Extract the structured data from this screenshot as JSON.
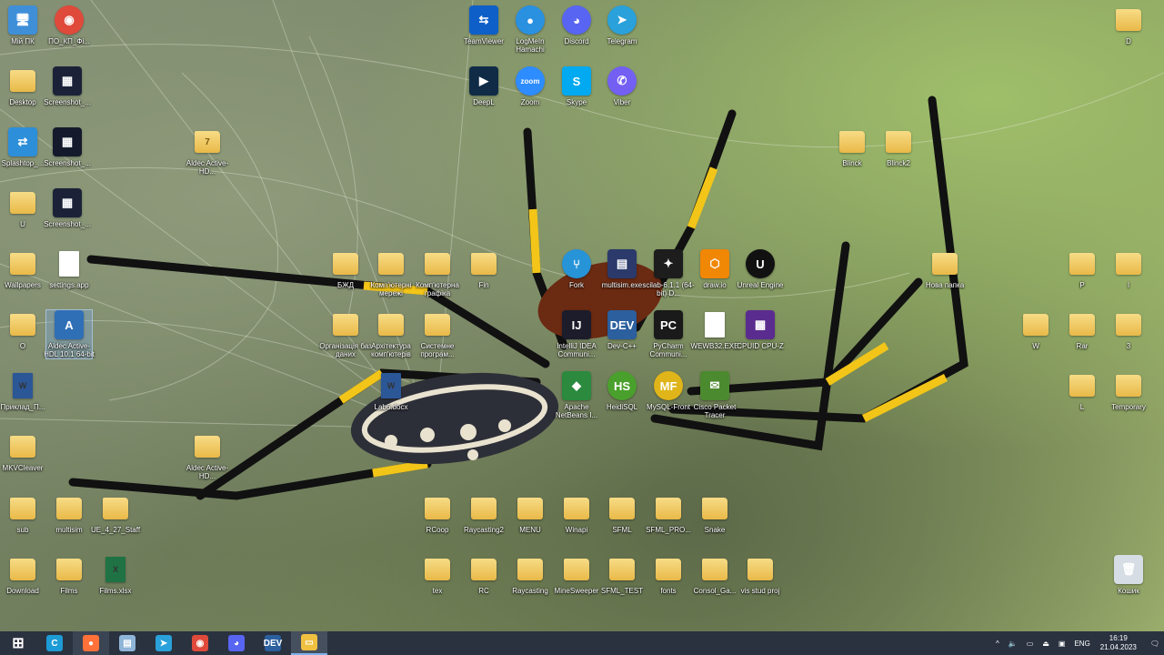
{
  "desktop": {
    "icons": [
      {
        "id": "my-pc",
        "label": "Мій ПК",
        "glyph": "🖥",
        "color": "#3f8fd8",
        "kind": "app"
      },
      {
        "id": "chrome-desktop",
        "label": "ПО_КП_Фі...",
        "glyph": "◉",
        "color": "#e04a3b",
        "kind": "round"
      },
      {
        "id": "desktop-folder",
        "label": "Desktop",
        "glyph": "",
        "kind": "folder"
      },
      {
        "id": "screenshot-1",
        "label": "Screenshot_...",
        "glyph": "▦",
        "color": "#1b2238",
        "kind": "app"
      },
      {
        "id": "splashtop",
        "label": "Splashtop_...",
        "glyph": "⇄",
        "color": "#2d8fd9",
        "kind": "app"
      },
      {
        "id": "screenshot-2",
        "label": "Screenshot_...",
        "glyph": "▦",
        "color": "#141a2c",
        "kind": "app"
      },
      {
        "id": "u-folder",
        "label": "U",
        "glyph": "",
        "kind": "folder"
      },
      {
        "id": "screenshot-3",
        "label": "Screenshot_...",
        "glyph": "▦",
        "color": "#1b2238",
        "kind": "app"
      },
      {
        "id": "wallpapers-folder",
        "label": "Wallpapers",
        "glyph": "",
        "kind": "folder"
      },
      {
        "id": "settings-app",
        "label": "settings.app",
        "glyph": "",
        "kind": "file"
      },
      {
        "id": "o-folder",
        "label": "O",
        "glyph": "",
        "kind": "folder"
      },
      {
        "id": "aldec-selected",
        "label": "Aldec Active-HDL 10.1 64-bit",
        "glyph": "A",
        "color": "#2f6fb6",
        "kind": "app"
      },
      {
        "id": "prykład",
        "label": "Приклад_П...",
        "glyph": "W",
        "color": "#2b5797",
        "kind": "file"
      },
      {
        "id": "mkvcleaver",
        "label": "MKVCleaver",
        "glyph": "",
        "kind": "folder"
      },
      {
        "id": "sub-folder",
        "label": "sub",
        "glyph": "",
        "kind": "folder"
      },
      {
        "id": "multisim-folder",
        "label": "multisim",
        "glyph": "",
        "kind": "folder"
      },
      {
        "id": "ue-staff",
        "label": "UE_4_27_Staff",
        "glyph": "",
        "kind": "folder"
      },
      {
        "id": "download-folder",
        "label": "Download",
        "glyph": "",
        "kind": "folder"
      },
      {
        "id": "films-folder",
        "label": "Films",
        "glyph": "",
        "kind": "folder"
      },
      {
        "id": "films-xlsx",
        "label": "Films.xlsx",
        "glyph": "X",
        "color": "#1f7244",
        "kind": "file"
      },
      {
        "id": "aldec-hdl-1",
        "label": "Aldec Active-HD...",
        "glyph": "7",
        "color": "#e9c35c",
        "kind": "folder"
      },
      {
        "id": "aldec-hdl-2",
        "label": "Aldec Active-HD...",
        "glyph": "",
        "kind": "folder"
      },
      {
        "id": "teamviewer",
        "label": "TeamViewer",
        "glyph": "⇆",
        "color": "#0e5fc8",
        "kind": "app"
      },
      {
        "id": "logmein",
        "label": "LogMeIn Hamachi",
        "glyph": "●",
        "color": "#2a90e0",
        "kind": "round"
      },
      {
        "id": "discord",
        "label": "Discord",
        "glyph": "◕",
        "color": "#5865f2",
        "kind": "round"
      },
      {
        "id": "telegram",
        "label": "Telegram",
        "glyph": "➤",
        "color": "#2aa1da",
        "kind": "round"
      },
      {
        "id": "deepl",
        "label": "DeepL",
        "glyph": "▶",
        "color": "#0f2b46",
        "kind": "app"
      },
      {
        "id": "zoom",
        "label": "Zoom",
        "glyph": "zoom",
        "color": "#2d8cff",
        "kind": "round"
      },
      {
        "id": "skype",
        "label": "Skype",
        "glyph": "S",
        "color": "#00a9f0",
        "kind": "app"
      },
      {
        "id": "viber",
        "label": "Viber",
        "glyph": "✆",
        "color": "#7360f2",
        "kind": "round"
      },
      {
        "id": "bzhd",
        "label": "БЖД",
        "glyph": "",
        "kind": "folder"
      },
      {
        "id": "komp-merezhi",
        "label": "Комп'ютерні мережі",
        "glyph": "",
        "kind": "folder"
      },
      {
        "id": "komp-grafika",
        "label": "Комп'ютерна графіка",
        "glyph": "",
        "kind": "folder"
      },
      {
        "id": "fin",
        "label": "Fin",
        "glyph": "",
        "kind": "folder"
      },
      {
        "id": "org-baz",
        "label": "Організація баз даних",
        "glyph": "",
        "kind": "folder"
      },
      {
        "id": "arkh-komp",
        "label": "Архітектура комп'ютерів",
        "glyph": "",
        "kind": "folder"
      },
      {
        "id": "systemne-prog",
        "label": "Системне програм...",
        "glyph": "",
        "kind": "folder"
      },
      {
        "id": "lab6",
        "label": "Lab6.docx",
        "glyph": "W",
        "color": "#2b5797",
        "kind": "file"
      },
      {
        "id": "fork",
        "label": "Fork",
        "glyph": "⑂",
        "color": "#2794d8",
        "kind": "round"
      },
      {
        "id": "multisim-exe",
        "label": "multisim.exe",
        "glyph": "▤",
        "color": "#2b3a6b",
        "kind": "app"
      },
      {
        "id": "scilab",
        "label": "scilab-6.1.1 (64-bit) D...",
        "glyph": "✦",
        "color": "#1d1d1d",
        "kind": "app"
      },
      {
        "id": "drawio",
        "label": "draw.io",
        "glyph": "⬡",
        "color": "#f08705",
        "kind": "app"
      },
      {
        "id": "unreal",
        "label": "Unreal Engine",
        "glyph": "U",
        "color": "#111111",
        "kind": "round"
      },
      {
        "id": "intellij",
        "label": "IntelliJ IDEA Communi...",
        "glyph": "IJ",
        "color": "#1c1c2a",
        "kind": "app"
      },
      {
        "id": "devcpp",
        "label": "Dev-C++",
        "glyph": "DEV",
        "color": "#2b5f9e",
        "kind": "app"
      },
      {
        "id": "pycharm",
        "label": "PyCharm Communi...",
        "glyph": "PC",
        "color": "#1a1a1a",
        "kind": "app"
      },
      {
        "id": "wewb32",
        "label": "WEWB32.EXE",
        "glyph": "",
        "kind": "file"
      },
      {
        "id": "cpuid",
        "label": "CPUID CPU-Z",
        "glyph": "▦",
        "color": "#5b2c8f",
        "kind": "app"
      },
      {
        "id": "netbeans",
        "label": "Apache NetBeans I...",
        "glyph": "◆",
        "color": "#2b8a3e",
        "kind": "app"
      },
      {
        "id": "heidisql",
        "label": "HeidiSQL",
        "glyph": "HS",
        "color": "#4aa02c",
        "kind": "round"
      },
      {
        "id": "mysql-front",
        "label": "MySQL-Front",
        "glyph": "MF",
        "color": "#e0b51a",
        "kind": "round"
      },
      {
        "id": "cisco-pt",
        "label": "Cisco Packet Tracer",
        "glyph": "✉",
        "color": "#4c8a2f",
        "kind": "app"
      },
      {
        "id": "rcoop",
        "label": "RCoop",
        "glyph": "",
        "kind": "folder"
      },
      {
        "id": "raycasting2",
        "label": "Raycasting2",
        "glyph": "",
        "kind": "folder"
      },
      {
        "id": "menu",
        "label": "MENU",
        "glyph": "",
        "kind": "folder"
      },
      {
        "id": "winapi",
        "label": "Winapi",
        "glyph": "",
        "kind": "folder"
      },
      {
        "id": "sfml",
        "label": "SFML",
        "glyph": "",
        "kind": "folder"
      },
      {
        "id": "sfml-pro",
        "label": "SFML_PRO...",
        "glyph": "",
        "kind": "folder"
      },
      {
        "id": "snake",
        "label": "Snake",
        "glyph": "",
        "kind": "folder"
      },
      {
        "id": "tex",
        "label": "tex",
        "glyph": "",
        "kind": "folder"
      },
      {
        "id": "rc",
        "label": "RC",
        "glyph": "",
        "kind": "folder"
      },
      {
        "id": "raycasting",
        "label": "Raycasting",
        "glyph": "",
        "kind": "folder"
      },
      {
        "id": "minesweeper",
        "label": "MineSweeper",
        "glyph": "",
        "kind": "folder"
      },
      {
        "id": "sfml-test",
        "label": "SFML_TEST",
        "glyph": "",
        "kind": "folder"
      },
      {
        "id": "fonts",
        "label": "fonts",
        "glyph": "",
        "kind": "folder"
      },
      {
        "id": "consol-ga",
        "label": "Consol_Ga...",
        "glyph": "",
        "kind": "folder"
      },
      {
        "id": "vis-stud",
        "label": "vis stud proj",
        "glyph": "",
        "kind": "folder"
      },
      {
        "id": "blinck",
        "label": "Blinck",
        "glyph": "",
        "kind": "folder"
      },
      {
        "id": "blinck2",
        "label": "Blinck2",
        "glyph": "",
        "kind": "folder"
      },
      {
        "id": "nova-papka",
        "label": "Нова папка",
        "glyph": "",
        "kind": "folder"
      },
      {
        "id": "d-folder",
        "label": "D",
        "glyph": "",
        "kind": "folder"
      },
      {
        "id": "p-folder",
        "label": "P",
        "glyph": "",
        "kind": "folder"
      },
      {
        "id": "i-folder",
        "label": "I",
        "glyph": "",
        "kind": "folder"
      },
      {
        "id": "w-folder",
        "label": "W",
        "glyph": "",
        "kind": "folder"
      },
      {
        "id": "rar-folder",
        "label": "Rar",
        "glyph": "",
        "kind": "folder"
      },
      {
        "id": "three-folder",
        "label": "3",
        "glyph": "",
        "kind": "folder"
      },
      {
        "id": "l-folder",
        "label": "L",
        "glyph": "",
        "kind": "folder"
      },
      {
        "id": "temporary",
        "label": "Temporary",
        "glyph": "",
        "kind": "folder"
      },
      {
        "id": "recycle-bin",
        "label": "Кошик",
        "glyph": "🗑",
        "color": "#d7dde4",
        "kind": "app"
      }
    ]
  },
  "taskbar": {
    "buttons": [
      {
        "id": "start",
        "glyph": "⊞",
        "color": "#ffffff"
      },
      {
        "id": "cortana",
        "glyph": "C",
        "color": "#1d9bd6"
      },
      {
        "id": "firefox",
        "glyph": "●",
        "color": "#ff7139"
      },
      {
        "id": "notepad",
        "glyph": "▤",
        "color": "#8fb5d8"
      },
      {
        "id": "telegram",
        "glyph": "➤",
        "color": "#2aa1da"
      },
      {
        "id": "chrome",
        "glyph": "◉",
        "color": "#e04a3b"
      },
      {
        "id": "discord",
        "glyph": "◕",
        "color": "#5865f2"
      },
      {
        "id": "devcpp",
        "glyph": "DEV",
        "color": "#2b5f9e"
      },
      {
        "id": "explorer",
        "glyph": "▭",
        "color": "#f0c040"
      }
    ],
    "tray": {
      "chevron": "^",
      "language": "ENG",
      "time": "16:19",
      "date": "21.04.2023"
    }
  }
}
